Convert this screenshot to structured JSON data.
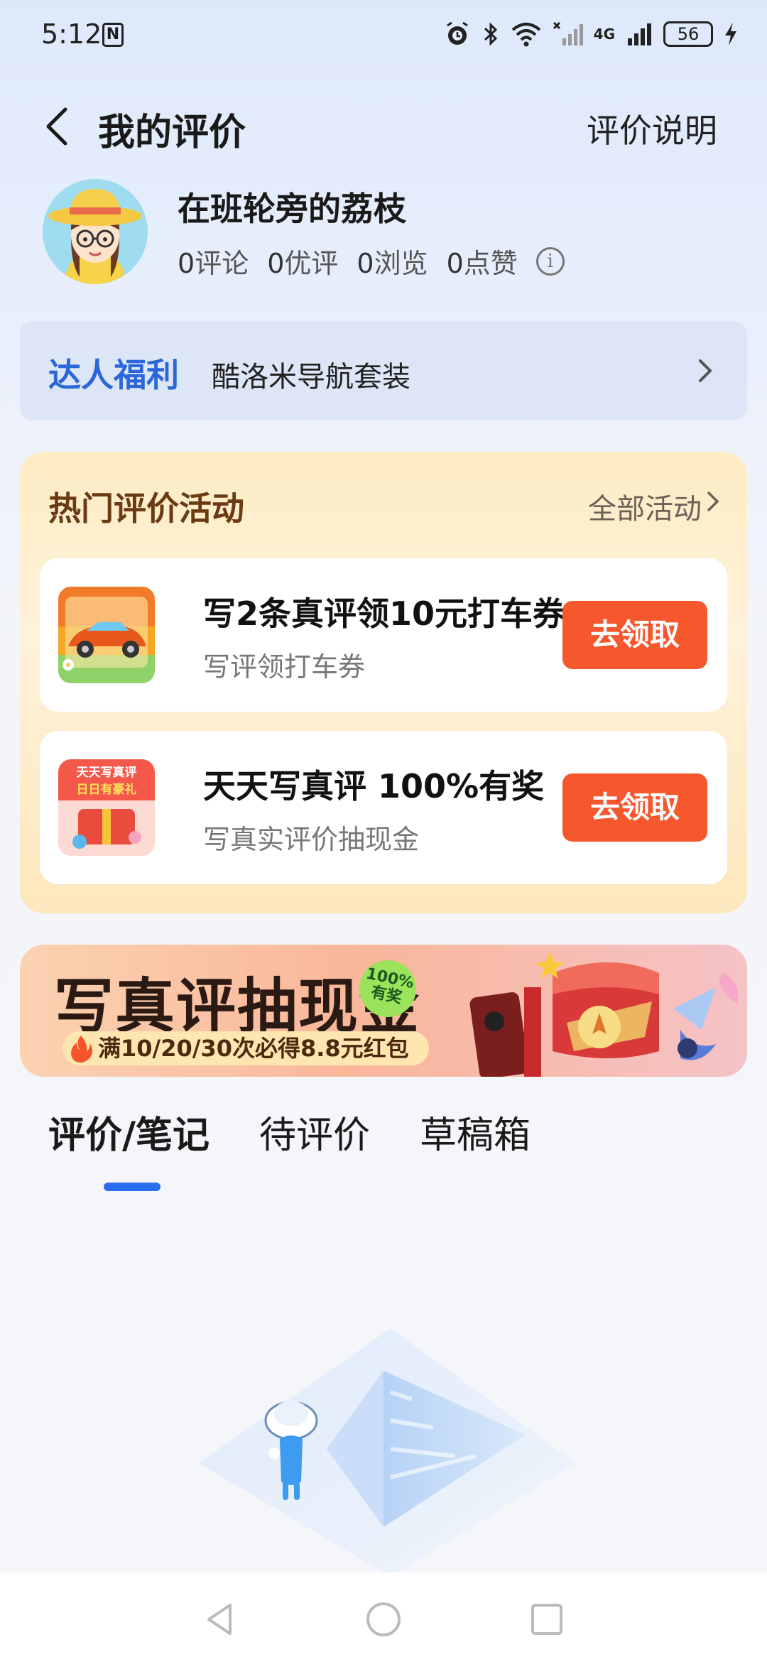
{
  "status_bar": {
    "time": "5:12",
    "n_icon": "N",
    "battery": "56",
    "network": "4G",
    "icons": [
      "alarm-icon",
      "bluetooth-icon",
      "wifi-icon",
      "signal-icon",
      "signal-4g-icon",
      "battery-icon",
      "charging-icon"
    ]
  },
  "header": {
    "title": "我的评价",
    "right_link": "评价说明"
  },
  "profile": {
    "username": "在班轮旁的荔枝",
    "stats": [
      {
        "value": "0",
        "label": "评论"
      },
      {
        "value": "0",
        "label": "优评"
      },
      {
        "value": "0",
        "label": "浏览"
      },
      {
        "value": "0",
        "label": "点赞"
      }
    ],
    "info_glyph": "i"
  },
  "perks": {
    "title": "达人福利",
    "text": "酷洛米导航套装"
  },
  "activities": {
    "title": "热门评价活动",
    "all_link": "全部活动",
    "items": [
      {
        "name": "写2条真评领10元打车券",
        "sub": "写评领打车券",
        "button": "去领取"
      },
      {
        "name": "天天写真评 100%有奖",
        "sub": "写真实评价抽现金",
        "button": "去领取",
        "thumb_text": "天天写真评",
        "thumb_text2": "日日有豪礼"
      }
    ]
  },
  "banner": {
    "title": "写真评抽现金",
    "badge_line1": "100%",
    "badge_line2": "有奖",
    "subtitle": "满10/20/30次必得8.8元红包"
  },
  "tabs": [
    {
      "label": "评价/笔记",
      "active": true
    },
    {
      "label": "待评价",
      "active": false
    },
    {
      "label": "草稿箱",
      "active": false
    }
  ],
  "colors": {
    "accent_blue": "#2a6ef0",
    "perks_blue": "#2b67d8",
    "button_orange": "#f6572c",
    "activity_title_brown": "#6a3b12"
  }
}
